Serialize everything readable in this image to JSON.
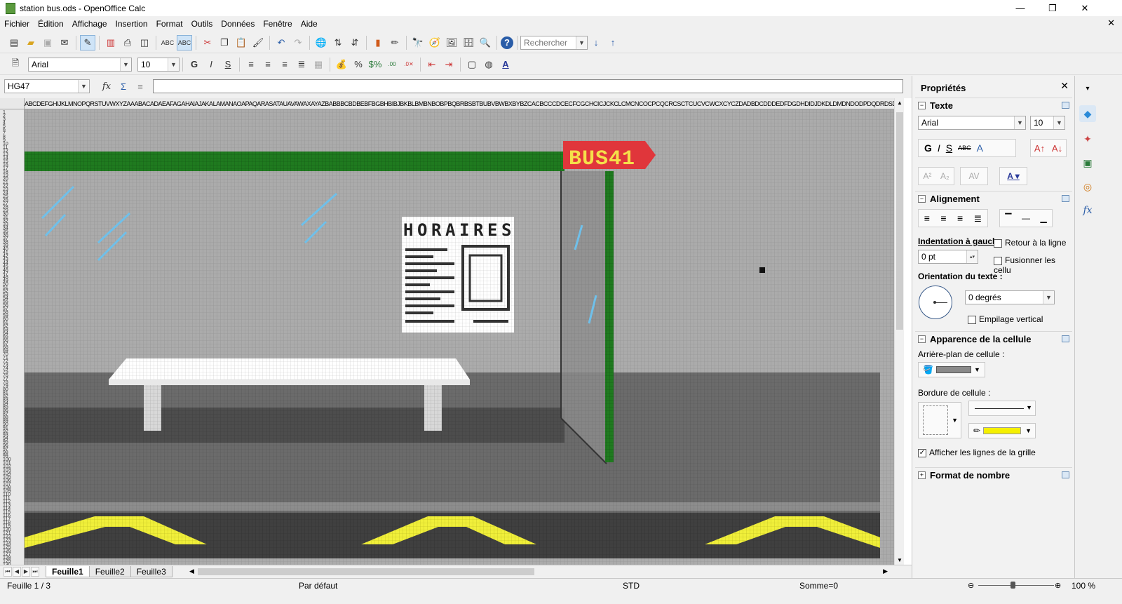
{
  "window": {
    "title": "station bus.ods - OpenOffice Calc",
    "minimize": "—",
    "maximize": "❐",
    "close": "✕",
    "doc_close": "✕"
  },
  "menu": [
    "Fichier",
    "Édition",
    "Affichage",
    "Insertion",
    "Format",
    "Outils",
    "Données",
    "Fenêtre",
    "Aide"
  ],
  "toolbar1": {
    "search_placeholder": "Rechercher"
  },
  "toolbar2": {
    "font": "Arial",
    "size": "10",
    "bold": "G",
    "italic": "I",
    "underline": "S"
  },
  "formula": {
    "namebox": "HG47",
    "fx": "fx",
    "sum": "Σ",
    "equals": "="
  },
  "grid": {
    "col_header_text": "ABCDEFGHIJKLMNOPQRSTUVWXYZAAABACADAEAFAGAHAIAJAKALAMANAOAPAQARASATAUAVAWAXAYAZBABBBCBDBEBFBGBHBIBJBKBLBMBNBOBPBQBRBSBTBUBVBWBXBYBZCACBCCCDCECFCGCHCICJCKCLCMCNCOCPCQCRCSCTCUCVCWCXCYCZDADBDCDDDEDFDGDHDIDJDKDLDMDNDODPDQDRDSDTDUDVDWDXDYDZEAEBECEDEEEFEGEHEIEJEKELEMENEOEPEQERESETEUEVEWEXEYEZFAFBFCFDFEFFFGFHFIFJFKFLFMFNFOFPFQFRFSFTFUFVFWFXFYFZGAGBGCGDGEGFGGGHGIGJGKGLGMGNGOGPGQGRGSGTGUGVGWGXGYGZHAHBHCHDHEHFHGHHHIHJHKHLHMHNHOHPHQHRHSHTHUHVHWHXHYHZ",
    "sign_text": "BUS41",
    "schedule_title": "HORAIRES",
    "colors": {
      "bg_light": "#a9a9a9",
      "bg_dark": "#5e5e5e",
      "road": "#3a3a3a",
      "green": "#1f7a1f",
      "sign_red": "#e0363b",
      "sign_yellow": "#f5e04a",
      "yellow_lines": "#f0ef3a",
      "glass_blue": "#6fc0ea"
    }
  },
  "tabs": {
    "nav": [
      "⏮",
      "◀",
      "▶",
      "⏭"
    ],
    "sheets": [
      "Feuille1",
      "Feuille2",
      "Feuille3"
    ],
    "active": "Feuille1"
  },
  "status": {
    "sheet": "Feuille 1 / 3",
    "style": "Par défaut",
    "mode": "STD",
    "sum": "Somme=0",
    "zoom": "100 %"
  },
  "sidebar": {
    "title": "Propriétés",
    "text_section": "Texte",
    "font": "Arial",
    "size": "10",
    "align_section": "Alignement",
    "indent_label": "Indentation à gauch",
    "indent_value": "0 pt",
    "wrap_label": "Retour à la ligne",
    "merge_label": "Fusionner les cellu",
    "orientation_label": "Orientation du texte :",
    "degrees": "0 degrés",
    "stack_label": "Empilage vertical",
    "cell_section": "Apparence de la cellule",
    "bg_label": "Arrière-plan de cellule :",
    "border_label": "Bordure de cellule :",
    "gridlines_label": "Afficher les lignes de la grille",
    "numformat_section": "Format de nombre"
  }
}
